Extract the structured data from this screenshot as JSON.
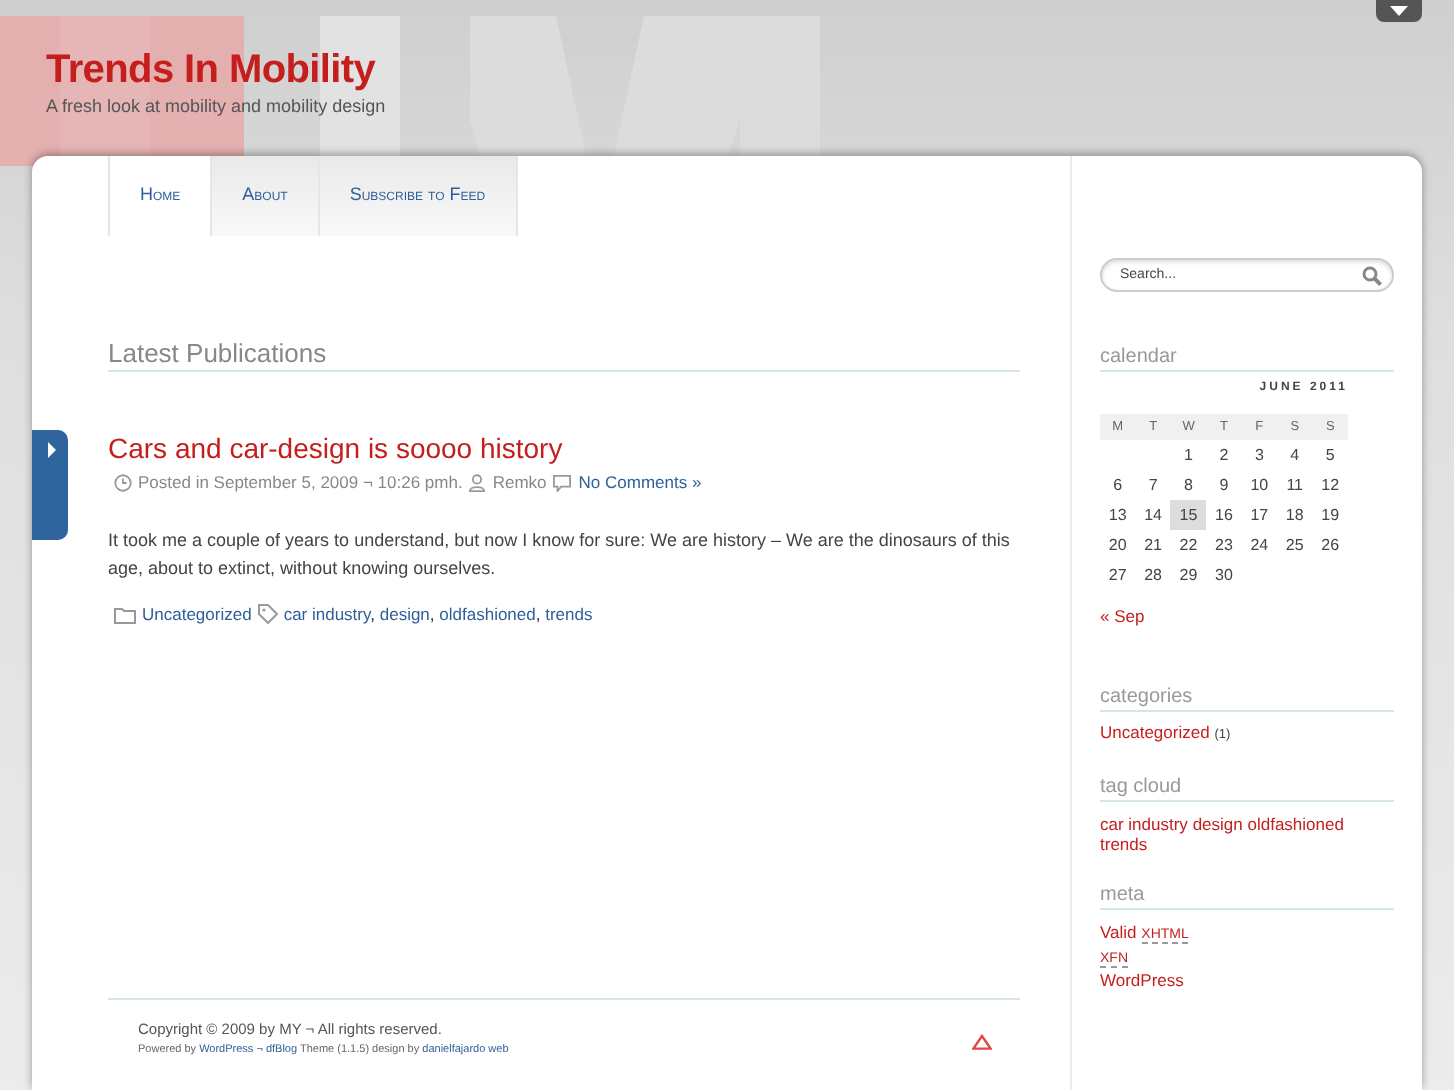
{
  "site": {
    "title": "Trends In Mobility",
    "tagline": "A fresh look at mobility and mobility design"
  },
  "nav": [
    {
      "label": "Home",
      "selected": true
    },
    {
      "label": "About",
      "selected": false
    },
    {
      "label": "Subscribe to Feed",
      "selected": false
    }
  ],
  "search": {
    "placeholder": "Search..."
  },
  "section_heading": "Latest Publications",
  "post": {
    "title": "Cars and car-design is soooo history",
    "posted": "Posted in September 5, 2009 ¬ 10:26 pmh.",
    "author": "Remko",
    "comments": "No Comments »",
    "body": "It took me  a couple of years to understand, but now I know for sure:  We are history – We are the dinosaurs of this age, about to extinct, without knowing ourselves.",
    "category": "Uncategorized",
    "tag_separator": ",",
    "tags": [
      "car industry",
      "design",
      "oldfashioned",
      "trends"
    ]
  },
  "footer": {
    "copyright": "Copyright © 2009 by MY ¬ All rights reserved.",
    "powered": [
      {
        "text": "Powered by",
        "link": false
      },
      {
        "text": "WordPress ¬ dfBlog",
        "link": true
      },
      {
        "text": "Theme (1.1.5) design by",
        "link": false
      },
      {
        "text": "danielfajardo web",
        "link": true
      }
    ]
  },
  "sidebar": {
    "calendar": {
      "heading": "calendar",
      "caption": "JUNE 2011",
      "weekdays": [
        "M",
        "T",
        "W",
        "T",
        "F",
        "S",
        "S"
      ],
      "weeks": [
        [
          {
            "label": "1",
            "selected": false
          },
          {
            "label": "2",
            "selected": false
          },
          {
            "label": "3",
            "selected": false
          },
          {
            "label": "4",
            "selected": false
          },
          {
            "label": "5",
            "selected": false
          }
        ],
        [
          {
            "label": "6",
            "selected": false
          },
          {
            "label": "7",
            "selected": false
          },
          {
            "label": "8",
            "selected": false
          },
          {
            "label": "9",
            "selected": false
          },
          {
            "label": "10",
            "selected": false
          },
          {
            "label": "11",
            "selected": false
          },
          {
            "label": "12",
            "selected": false
          }
        ],
        [
          {
            "label": "13",
            "selected": false
          },
          {
            "label": "14",
            "selected": false
          },
          {
            "label": "15",
            "selected": true
          },
          {
            "label": "16",
            "selected": false
          },
          {
            "label": "17",
            "selected": false
          },
          {
            "label": "18",
            "selected": false
          },
          {
            "label": "19",
            "selected": false
          }
        ],
        [
          {
            "label": "20",
            "selected": false
          },
          {
            "label": "21",
            "selected": false
          },
          {
            "label": "22",
            "selected": false
          },
          {
            "label": "23",
            "selected": false
          },
          {
            "label": "24",
            "selected": false
          },
          {
            "label": "25",
            "selected": false
          },
          {
            "label": "26",
            "selected": false
          }
        ],
        [
          {
            "label": "27",
            "selected": false
          },
          {
            "label": "28",
            "selected": false
          },
          {
            "label": "29",
            "selected": false
          },
          {
            "label": "30",
            "selected": false
          }
        ]
      ],
      "prev": "« Sep"
    },
    "categories": {
      "heading": "categories",
      "items": [
        {
          "label": "Uncategorized",
          "count": "(1)"
        }
      ]
    },
    "tag_cloud": {
      "heading": "tag cloud",
      "tags": [
        "car industry",
        "design",
        "oldfashioned",
        "trends"
      ]
    },
    "meta": {
      "heading": "meta",
      "items": [
        {
          "kind": "link_abbr",
          "label": "Valid",
          "abbr": "XHTML"
        },
        {
          "kind": "abbr",
          "abbr": "XFN"
        },
        {
          "kind": "link",
          "label": "WordPress"
        }
      ]
    }
  }
}
